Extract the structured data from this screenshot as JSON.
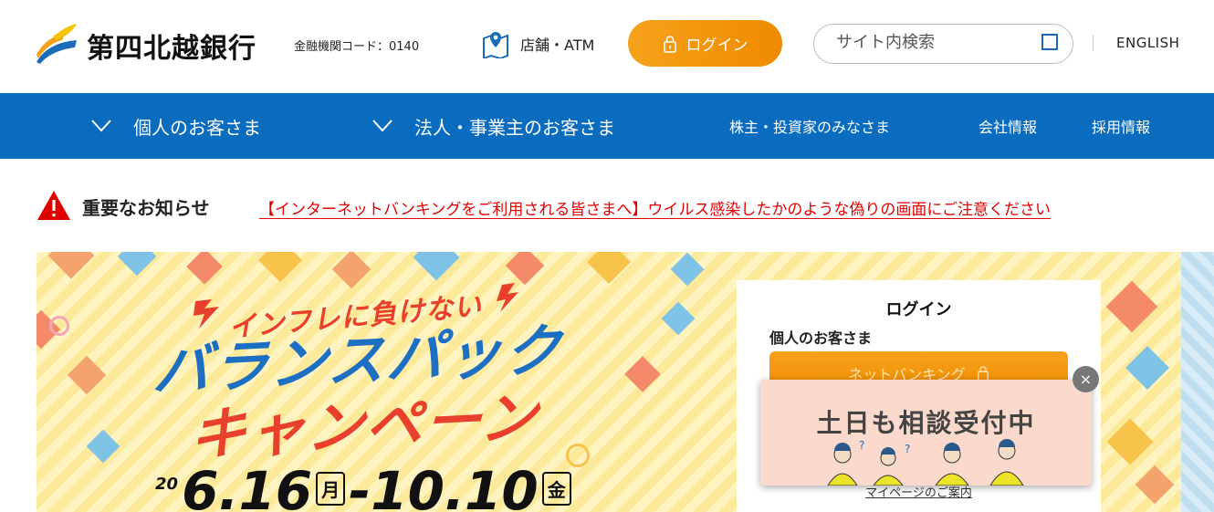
{
  "header": {
    "brand": "第四北越銀行",
    "bank_code": "金融機関コード：0140",
    "store_atm": "店舗・ATM",
    "login": "ログイン",
    "search_placeholder": "サイト内検索",
    "english": "ENGLISH"
  },
  "nav": {
    "items": [
      {
        "label": "個人のお客さま"
      },
      {
        "label": "法人・事業主のお客さま"
      },
      {
        "label": "株主・投資家のみなさま"
      },
      {
        "label": "会社情報"
      },
      {
        "label": "採用情報"
      }
    ]
  },
  "notice": {
    "title": "重要なお知らせ",
    "link": "【インターネットバンキングをご利用される皆さまへ】ウイルス感染したかのような偽りの画面にご注意ください"
  },
  "banner": {
    "tagline": "インフレに負けない",
    "title_line1": "バランスパック",
    "title_line2": "キャンペーン",
    "year": "20",
    "start": "6.16",
    "start_dow": "月",
    "sep": "-",
    "end": "10.10",
    "end_dow": "金"
  },
  "login_card": {
    "title": "ログイン",
    "subtitle": "個人のお客さま",
    "button": "ネットバンキング",
    "mypage": "マイページのご案内"
  },
  "popup": {
    "text": "土日も相談受付中",
    "close": "×"
  },
  "colors": {
    "nav_bg": "#0a6cbf",
    "accent_orange": "#f08a00",
    "alert_red": "#e00000"
  }
}
